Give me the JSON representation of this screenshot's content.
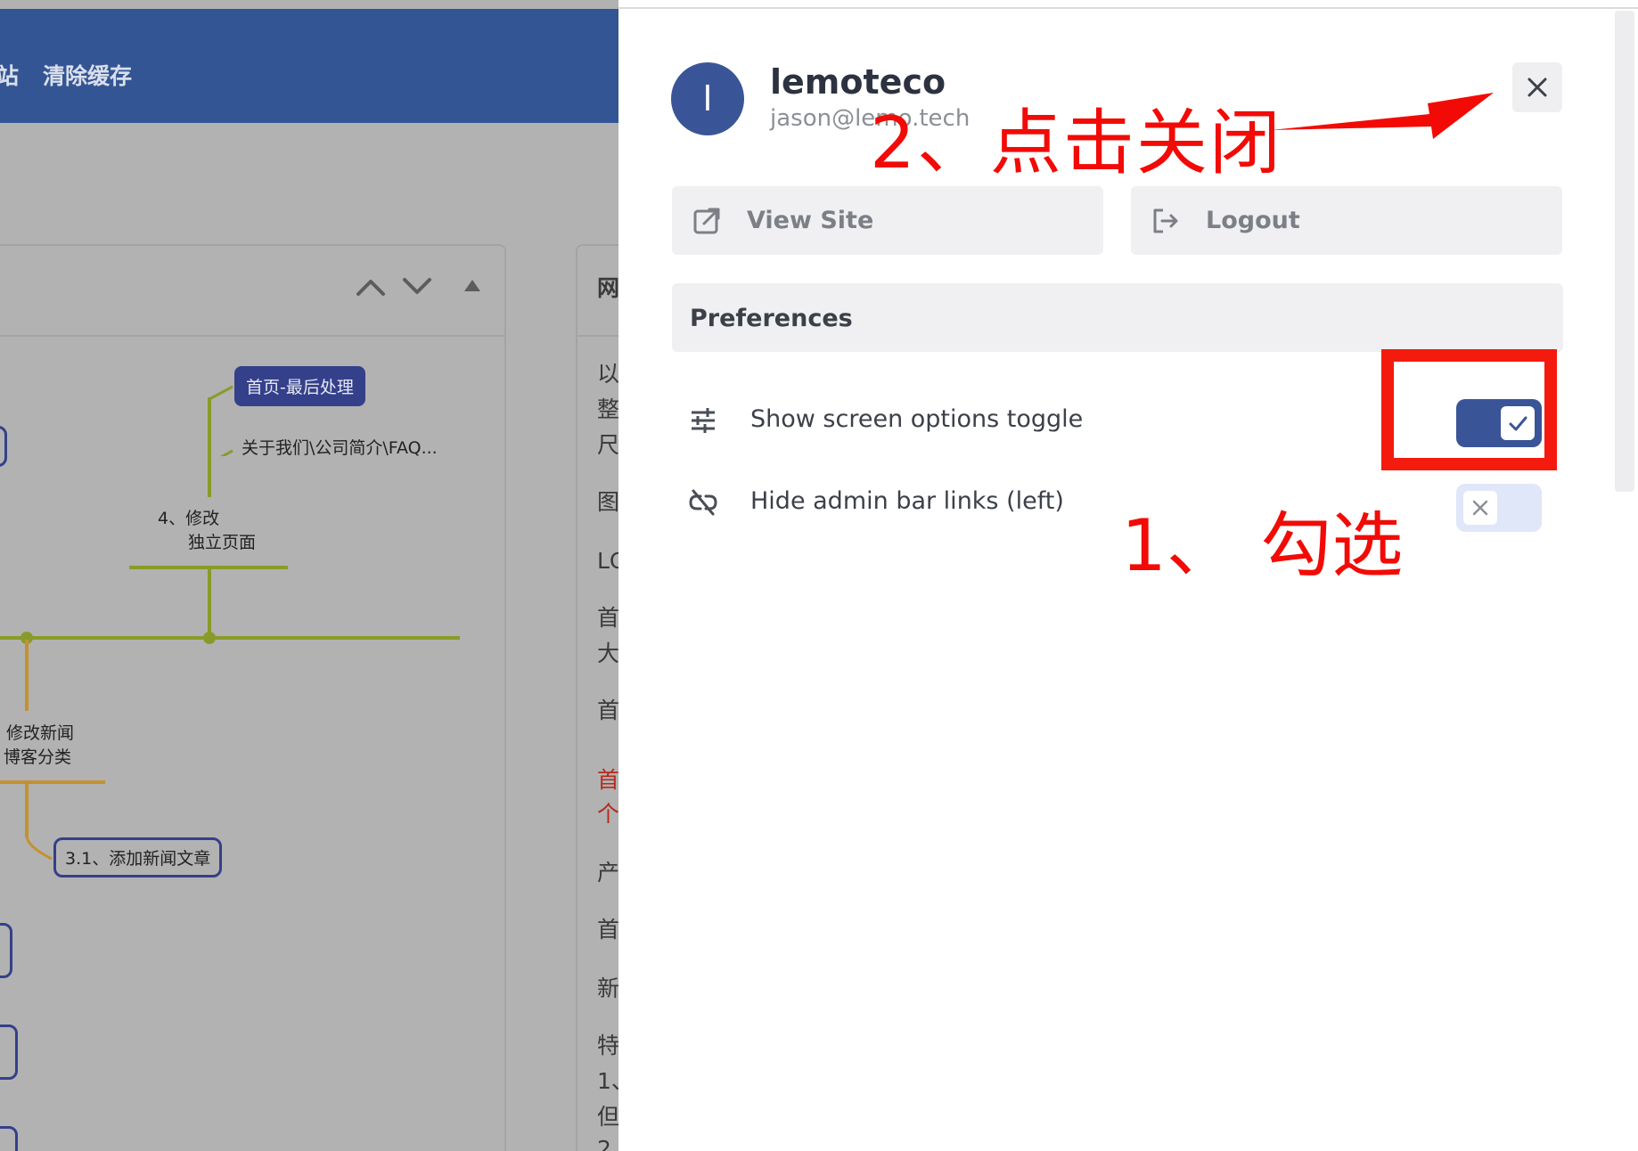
{
  "background": {
    "topbar_items": [
      "站",
      "清除缓存"
    ],
    "panel_controls": [
      "chevron-up",
      "chevron-down",
      "triangle-up"
    ],
    "mindmap": {
      "node_homepage": "首页-最后处理",
      "about_text": "关于我们\\公司简介\\FAQ...",
      "step4_line1": "4、修改",
      "step4_line2": "独立页面",
      "news_line1": "修改新闻",
      "news_line2": "博客分类",
      "node_add_news": "3.1、添加新闻文章"
    },
    "right_panel_heading": "网",
    "right_panel_lines": [
      "以",
      "整",
      "尺",
      "图",
      "LC",
      "首",
      "大",
      "首",
      "首",
      "个",
      "产",
      "首",
      "新",
      "特",
      "1、",
      "但",
      "2"
    ]
  },
  "drawer": {
    "avatar_letter": "l",
    "user_name": "lemoteco",
    "user_email": "jason@lemo.tech",
    "close_icon": "close-icon",
    "view_site_label": "View Site",
    "logout_label": "Logout",
    "preferences_heading": "Preferences",
    "pref_show_screen_options": "Show screen options toggle",
    "pref_hide_admin_bar": "Hide admin bar links (left)",
    "toggle_show_screen_options_on": true,
    "toggle_hide_admin_bar_on": false
  },
  "annotations": {
    "step_close": "2、点击关闭",
    "step_check": "1、 勾选",
    "color": "#f20b06"
  },
  "colors": {
    "brand": "#3a5597",
    "topbar": "#345594",
    "button_bg": "#f0f0f2"
  }
}
